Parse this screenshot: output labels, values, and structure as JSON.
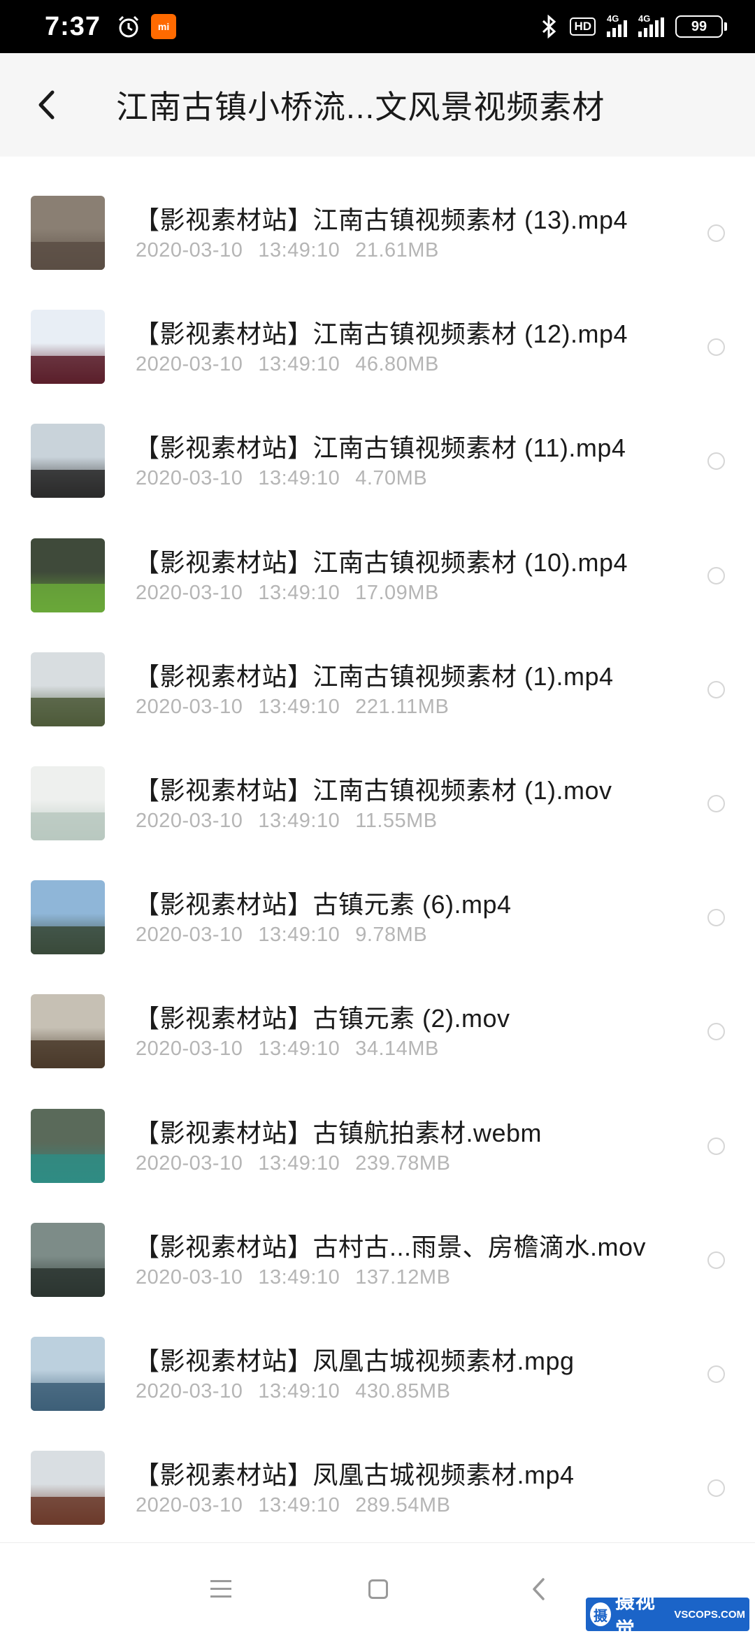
{
  "status_bar": {
    "time": "7:37",
    "network_1": "4G",
    "network_2": "4G",
    "hd": "HD",
    "battery": "99",
    "mi_badge": "mi"
  },
  "header": {
    "title": "江南古镇小桥流...文风景视频素材"
  },
  "files": [
    {
      "name": "【影视素材站】江南古镇视频素材 (13).mp4",
      "date": "2020-03-10",
      "time": "13:49:10",
      "size": "21.61MB",
      "thumb": [
        "#8a7f73",
        "#5a4e44"
      ]
    },
    {
      "name": "【影视素材站】江南古镇视频素材 (12).mp4",
      "date": "2020-03-10",
      "time": "13:49:10",
      "size": "46.80MB",
      "thumb": [
        "#e8eef5",
        "#5b1f2a"
      ]
    },
    {
      "name": "【影视素材站】江南古镇视频素材 (11).mp4",
      "date": "2020-03-10",
      "time": "13:49:10",
      "size": "4.70MB",
      "thumb": [
        "#c9d3da",
        "#2a2a2a"
      ]
    },
    {
      "name": "【影视素材站】江南古镇视频素材 (10).mp4",
      "date": "2020-03-10",
      "time": "13:49:10",
      "size": "17.09MB",
      "thumb": [
        "#3f4a3a",
        "#6aa83a"
      ]
    },
    {
      "name": "【影视素材站】江南古镇视频素材 (1).mp4",
      "date": "2020-03-10",
      "time": "13:49:10",
      "size": "221.11MB",
      "thumb": [
        "#d8dde0",
        "#4d5a3a"
      ]
    },
    {
      "name": "【影视素材站】江南古镇视频素材 (1).mov",
      "date": "2020-03-10",
      "time": "13:49:10",
      "size": "11.55MB",
      "thumb": [
        "#eef0ee",
        "#b8c8c0"
      ]
    },
    {
      "name": "【影视素材站】古镇元素 (6).mp4",
      "date": "2020-03-10",
      "time": "13:49:10",
      "size": "9.78MB",
      "thumb": [
        "#8fb6d8",
        "#3a4a3a"
      ]
    },
    {
      "name": "【影视素材站】古镇元素 (2).mov",
      "date": "2020-03-10",
      "time": "13:49:10",
      "size": "34.14MB",
      "thumb": [
        "#c6c0b4",
        "#4a3a2a"
      ]
    },
    {
      "name": "【影视素材站】古镇航拍素材.webm",
      "date": "2020-03-10",
      "time": "13:49:10",
      "size": "239.78MB",
      "thumb": [
        "#5a6a5a",
        "#2f8c84"
      ]
    },
    {
      "name": "【影视素材站】古村古...雨景、房檐滴水.mov",
      "date": "2020-03-10",
      "time": "13:49:10",
      "size": "137.12MB",
      "thumb": [
        "#7d8c88",
        "#2b3530"
      ]
    },
    {
      "name": "【影视素材站】凤凰古城视频素材.mpg",
      "date": "2020-03-10",
      "time": "13:49:10",
      "size": "430.85MB",
      "thumb": [
        "#bcd0de",
        "#3d5f78"
      ]
    },
    {
      "name": "【影视素材站】凤凰古城视频素材.mp4",
      "date": "2020-03-10",
      "time": "13:49:10",
      "size": "289.54MB",
      "thumb": [
        "#d9dee2",
        "#6b3a2a"
      ]
    }
  ],
  "watermark": {
    "logo_char": "摄",
    "text": "摄视觉",
    "domain": "VSCOPS.COM"
  },
  "colors": {
    "header_bg": "#f6f6f6",
    "meta_text": "#b5b5b5",
    "watermark_bg": "#1b64c8"
  }
}
